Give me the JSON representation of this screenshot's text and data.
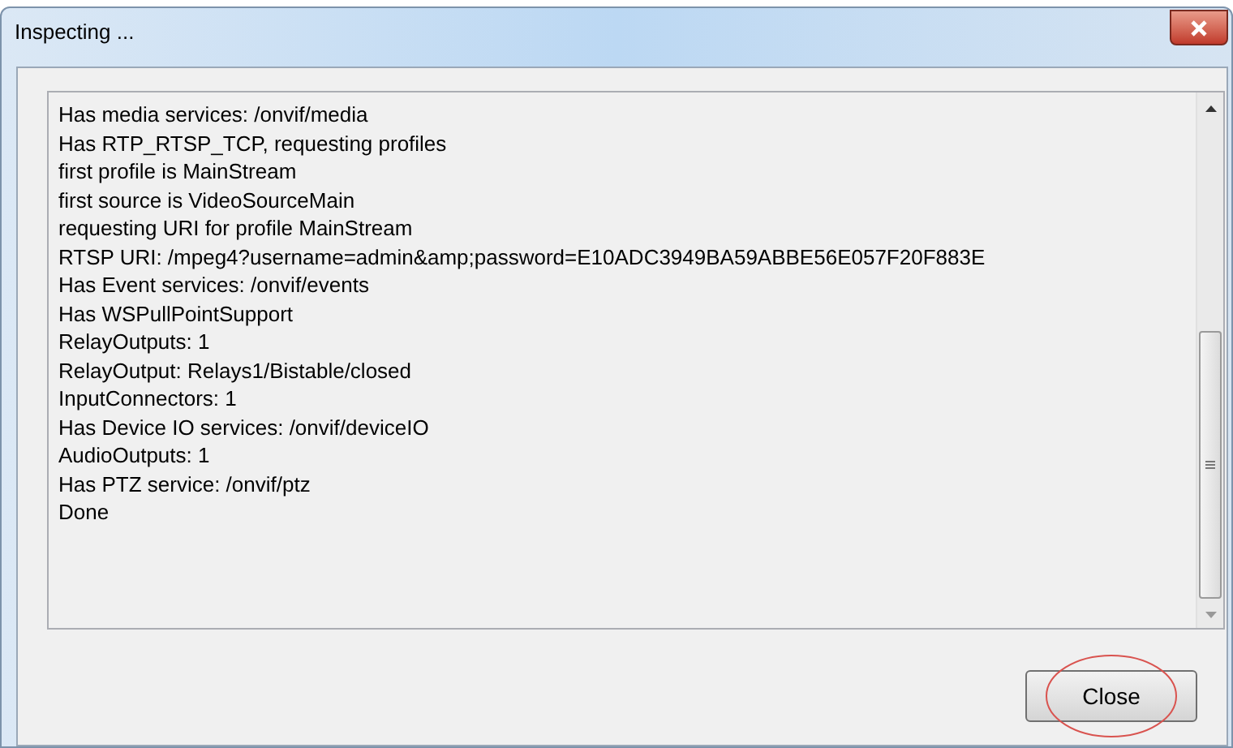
{
  "window": {
    "title": "Inspecting ..."
  },
  "log_lines": [
    "Has media services: /onvif/media",
    "Has RTP_RTSP_TCP, requesting profiles",
    "first profile is MainStream",
    "first source is VideoSourceMain",
    "requesting URI for profile MainStream",
    "RTSP URI: /mpeg4?username=admin&amp;password=E10ADC3949BA59ABBE56E057F20F883E",
    "Has Event services: /onvif/events",
    "Has WSPullPointSupport",
    "RelayOutputs: 1",
    "RelayOutput: Relays1/Bistable/closed",
    "InputConnectors: 1",
    "Has Device IO services: /onvif/deviceIO",
    "AudioOutputs: 1",
    "Has PTZ service: /onvif/ptz",
    "Done"
  ],
  "buttons": [
    {
      "label": "Close",
      "highlighted": true
    }
  ]
}
